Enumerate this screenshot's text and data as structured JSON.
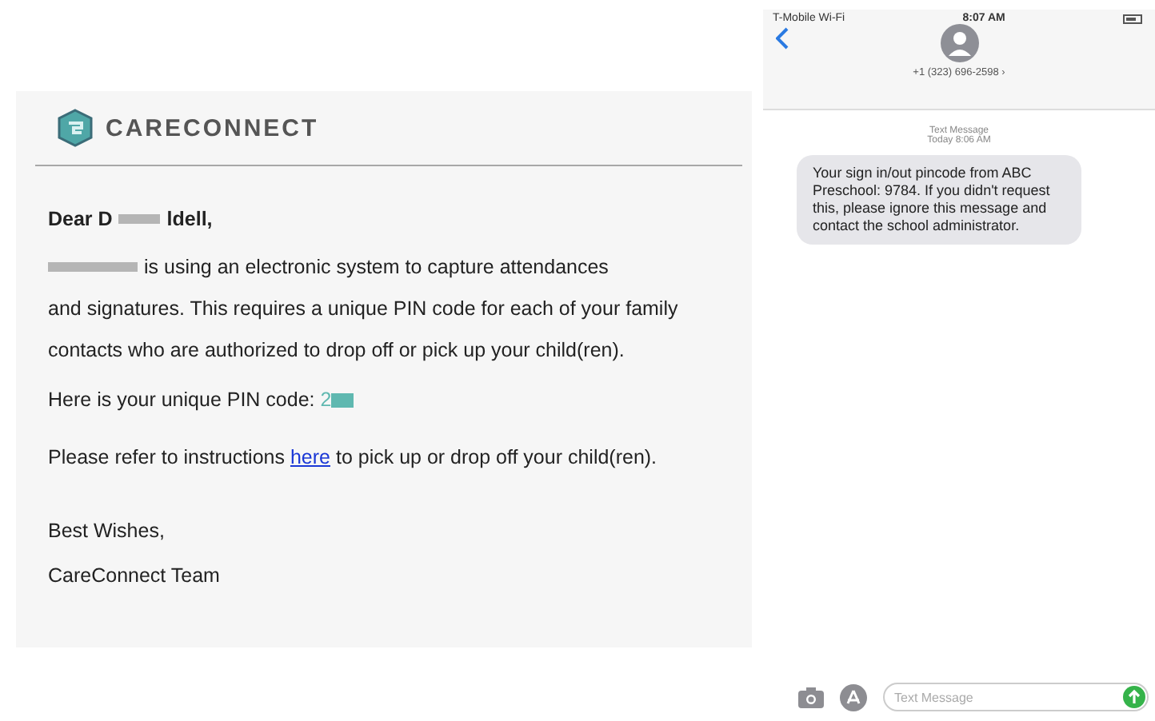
{
  "email": {
    "brand": "CARECONNECT",
    "greeting": {
      "before": "Dear D",
      "after": "ldell,"
    },
    "paragraph_1": {
      "first_line": "is using an electronic system to capture attendances",
      "rest": "and signatures. This requires a unique PIN code for each of your family contacts who are authorized to drop off or pick up your child(ren)."
    },
    "pin_line": {
      "label": "Here is your unique PIN code:",
      "pin_visible": "2"
    },
    "instructions": {
      "before": "Please refer to instructions",
      "link": "here",
      "after": "to pick up or drop off your child(ren)."
    },
    "closing": "Best Wishes,",
    "signature": "CareConnect Team"
  },
  "phone": {
    "status_bar": {
      "carrier": "T-Mobile Wi-Fi",
      "time": "8:07 AM"
    },
    "contact": "+1 (323) 696-2598 ›",
    "thread_label": "Text Message",
    "thread_time": "Today 8:06 AM",
    "messages": [
      {
        "kind": "incoming",
        "text": "Your sign in/out pincode from ABC Preschool: 9784. If you didn't request this, please ignore this message and contact the school administrator."
      }
    ],
    "composer": {
      "placeholder": "Text Message"
    }
  }
}
